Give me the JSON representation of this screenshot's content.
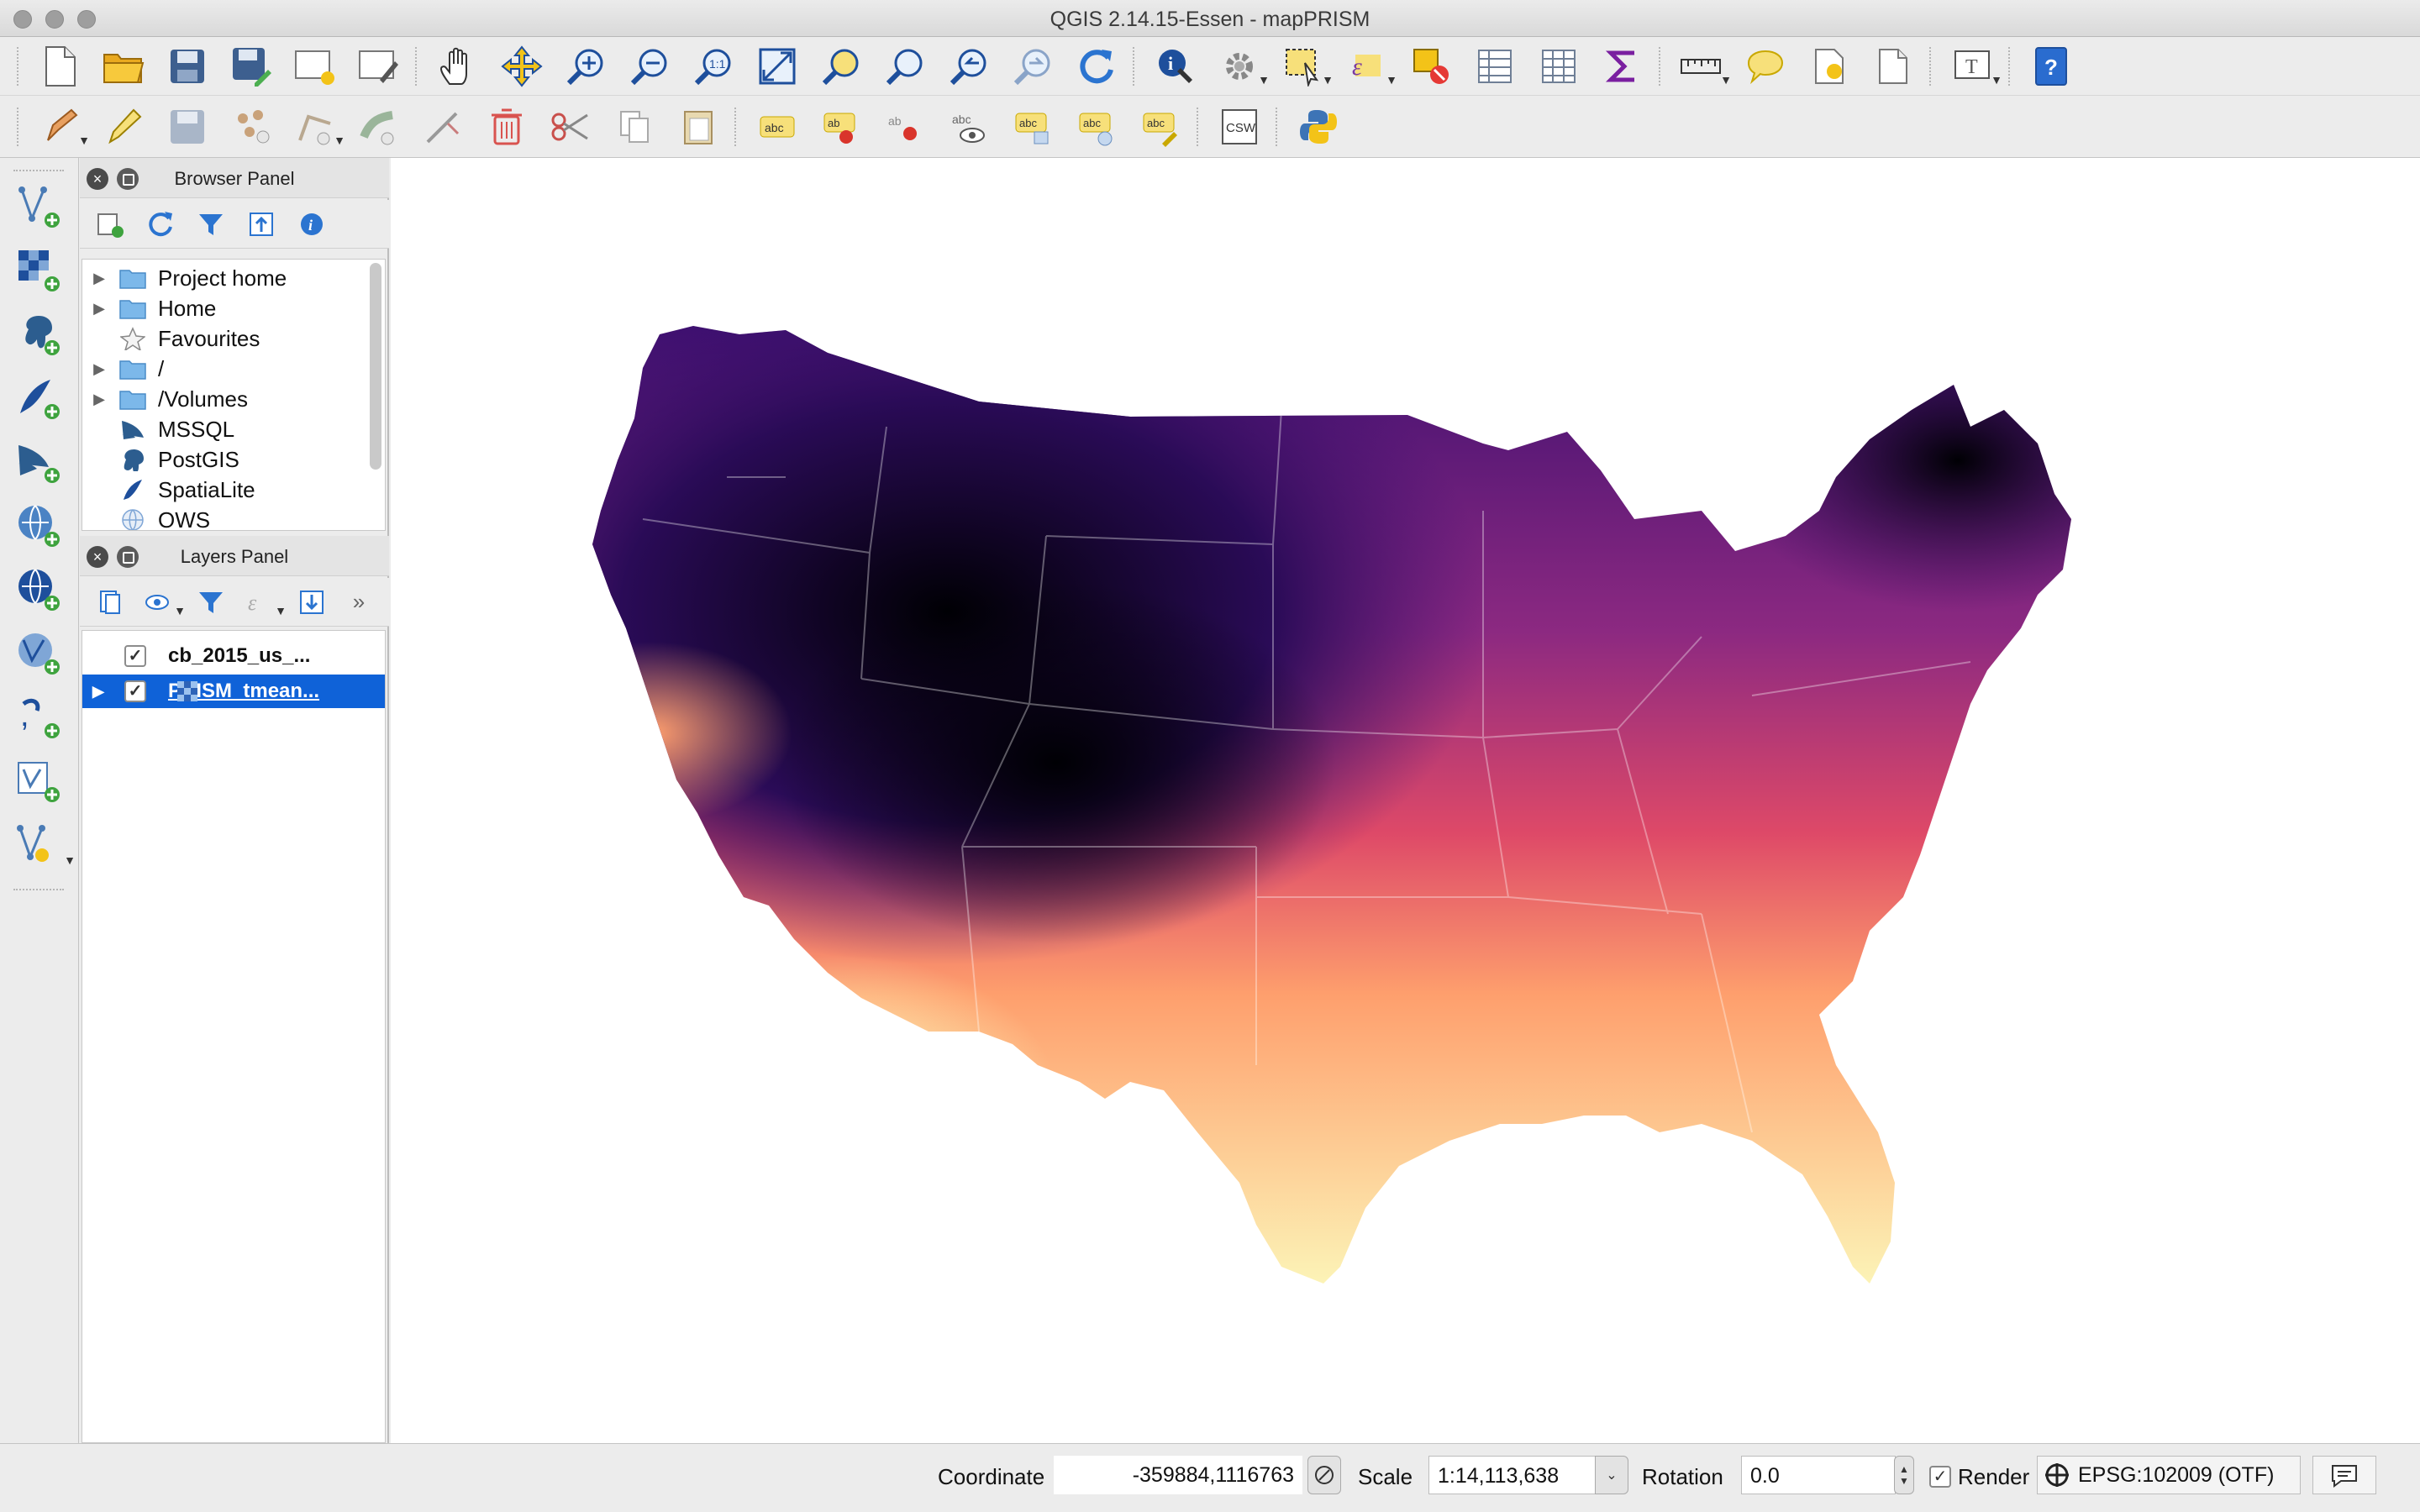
{
  "window": {
    "title": "QGIS 2.14.15-Essen - mapPRISM"
  },
  "toolbar_main": {
    "icons": [
      "new-project",
      "open-project",
      "save-project",
      "save-project-as",
      "new-print-composer",
      "composer-manager",
      "pan",
      "pan-to-selection",
      "zoom-in",
      "zoom-out",
      "zoom-actual",
      "zoom-full",
      "zoom-to-selection",
      "zoom-to-layer",
      "zoom-last",
      "zoom-next",
      "refresh",
      "identify",
      "run-action",
      "select-features",
      "select-by-expression",
      "deselect",
      "attribute-table",
      "field-calculator",
      "statistical-summary",
      "measure",
      "map-tips",
      "new-bookmark",
      "show-bookmarks",
      "text-annotation",
      "help"
    ]
  },
  "toolbar_edit": {
    "icons": [
      "current-edits",
      "toggle-editing",
      "save-edits",
      "add-feature",
      "move-feature",
      "node-tool",
      "delete-selected",
      "cut-features",
      "copy-features",
      "paste-features",
      "layer-labeling",
      "pin-labels",
      "highlight-pinned",
      "show-hide-labels",
      "move-label",
      "rotate-label",
      "change-label",
      "csw",
      "python-console"
    ],
    "csw_label": "CSW",
    "abc_label": "abc"
  },
  "left_toolbar": {
    "icons": [
      "add-vector-layer",
      "add-raster-layer",
      "add-postgis-layer",
      "add-spatialite-layer",
      "add-mssql-layer",
      "add-wms-layer",
      "add-wcs-layer",
      "add-wfs-layer",
      "add-delimited-text-layer",
      "add-virtual-layer",
      "new-shapefile-layer"
    ]
  },
  "browser_panel": {
    "title": "Browser Panel",
    "items": [
      {
        "label": "Project home",
        "icon": "folder-icon",
        "expandable": true
      },
      {
        "label": "Home",
        "icon": "folder-icon",
        "expandable": true
      },
      {
        "label": "Favourites",
        "icon": "star-icon",
        "expandable": false
      },
      {
        "label": "/",
        "icon": "folder-icon",
        "expandable": true
      },
      {
        "label": "/Volumes",
        "icon": "folder-icon",
        "expandable": true
      },
      {
        "label": "MSSQL",
        "icon": "mssql-icon",
        "expandable": false
      },
      {
        "label": "PostGIS",
        "icon": "postgis-icon",
        "expandable": false
      },
      {
        "label": "SpatiaLite",
        "icon": "spatialite-icon",
        "expandable": false
      },
      {
        "label": "OWS",
        "icon": "ows-icon",
        "expandable": false
      }
    ]
  },
  "layers_panel": {
    "title": "Layers Panel",
    "layers": [
      {
        "name": "cb_2015_us_...",
        "visible": true,
        "selected": false,
        "type": "vector"
      },
      {
        "name": "PRISM_tmean...",
        "visible": true,
        "selected": true,
        "type": "raster"
      }
    ]
  },
  "colors": {
    "selection": "#0f62d8",
    "ramp": [
      "#000004",
      "#3b0f70",
      "#8c2981",
      "#de4968",
      "#fe9f6d",
      "#fcfdbf"
    ]
  },
  "statusbar": {
    "coordinate_label": "Coordinate",
    "coordinate_value": "-359884,1116763",
    "scale_label": "Scale",
    "scale_value": "1:14,113,638",
    "rotation_label": "Rotation",
    "rotation_value": "0.0",
    "render_label": "Render",
    "render_checked": true,
    "crs_value": "EPSG:102009 (OTF)"
  }
}
